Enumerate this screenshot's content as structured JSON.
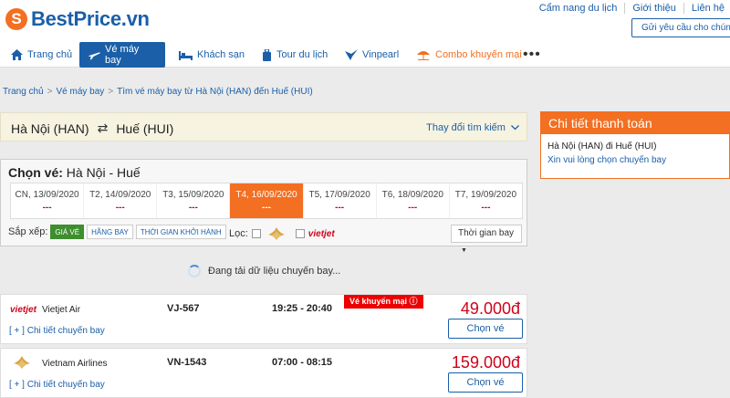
{
  "header": {
    "logo_text": "BestPrice.vn",
    "logo_mark": "S",
    "links": [
      "Cẩm nang du lịch",
      "Giới thiệu",
      "Liên hệ"
    ],
    "support_button": "Gửi yêu cầu cho chúng tôi"
  },
  "nav": {
    "items": [
      {
        "label": "Trang chủ",
        "icon": "home-icon"
      },
      {
        "label": "Vé máy bay",
        "icon": "plane-icon",
        "active": true
      },
      {
        "label": "Khách sạn",
        "icon": "bed-icon"
      },
      {
        "label": "Tour du lịch",
        "icon": "luggage-icon"
      },
      {
        "label": "Vinpearl",
        "icon": "vinpearl-icon"
      },
      {
        "label": "Combo khuyến mại",
        "icon": "beach-icon"
      }
    ],
    "more": "•••"
  },
  "breadcrumb": [
    "Trang chủ",
    "Vé máy bay",
    "Tìm vé máy bay từ Hà Nội (HAN) đến Huế (HUI)"
  ],
  "route": {
    "from": "Hà Nội (HAN)",
    "swap": "⇄",
    "to": "Huế (HUI)",
    "change": "Thay đổi tìm kiếm"
  },
  "choose": {
    "label": "Chọn vé:",
    "route": "Hà Nội - Huế",
    "dates": [
      {
        "day": "CN, 13/09/2020",
        "price": "---"
      },
      {
        "day": "T2, 14/09/2020",
        "price": "---"
      },
      {
        "day": "T3, 15/09/2020",
        "price": "---"
      },
      {
        "day": "T4, 16/09/2020",
        "price": "---",
        "active": true
      },
      {
        "day": "T5, 17/09/2020",
        "price": "---"
      },
      {
        "day": "T6, 18/09/2020",
        "price": "---"
      },
      {
        "day": "T7, 19/09/2020",
        "price": "---"
      }
    ],
    "sort_label": "Sắp xếp:",
    "sort_options": [
      "GIÁ VÉ",
      "HÃNG BAY",
      "THỜI GIAN KHỞI HÀNH"
    ],
    "filter_label": "Lọc:",
    "filter_vietjet": "vietjet",
    "sort_time": "Thời gian bay"
  },
  "loading": "Đang tải dữ liệu chuyến bay...",
  "flights": [
    {
      "logo": "vietjet",
      "airline": "Vietjet Air",
      "number": "VJ-567",
      "time": "19:25 - 20:40",
      "promo": "Vé khuyến mại",
      "price": "49.000đ",
      "detail": "[ + ] Chi tiết chuyến bay",
      "button": "Chọn vé"
    },
    {
      "logo": "vna",
      "airline": "Vietnam Airlines",
      "number": "VN-1543",
      "time": "07:00 - 08:15",
      "price": "159.000đ",
      "detail": "[ + ] Chi tiết chuyến bay",
      "button": "Chọn vé"
    }
  ],
  "sidebar": {
    "title": "Chi tiết thanh toán",
    "route": "Hà Nội (HAN) đi Huế (HUI)",
    "hint": "Xin vui lòng chọn chuyến bay"
  },
  "colors": {
    "brand_blue": "#1a5fa8",
    "orange": "#f36f21",
    "price_red": "#d0021b"
  }
}
